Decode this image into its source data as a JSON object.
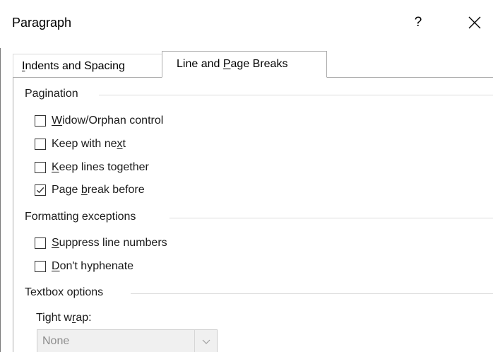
{
  "dialog": {
    "title": "Paragraph",
    "help_label": "?",
    "close_icon": "close-icon"
  },
  "tabs": [
    {
      "label_pre": "",
      "label_ul": "I",
      "label_post": "ndents and Spacing",
      "active": false
    },
    {
      "label_pre": "Line and ",
      "label_ul": "P",
      "label_post": "age Breaks",
      "active": true
    }
  ],
  "pagination": {
    "header": "Pagination",
    "items": [
      {
        "pre": "",
        "ul": "W",
        "post": "idow/Orphan control",
        "checked": false
      },
      {
        "pre": "Keep with ne",
        "ul": "x",
        "post": "t",
        "checked": false
      },
      {
        "pre": "",
        "ul": "K",
        "post": "eep lines together",
        "checked": false
      },
      {
        "pre": "Page ",
        "ul": "b",
        "post": "reak before",
        "checked": true
      }
    ]
  },
  "formatting": {
    "header": "Formatting exceptions",
    "items": [
      {
        "pre": "",
        "ul": "S",
        "post": "uppress line numbers",
        "checked": false
      },
      {
        "pre": "",
        "ul": "D",
        "post": "on't hyphenate",
        "checked": false
      }
    ]
  },
  "textbox": {
    "header": "Textbox options",
    "tight_wrap_pre": "Tight w",
    "tight_wrap_ul": "r",
    "tight_wrap_post": "ap:",
    "tight_wrap_value": "None"
  },
  "colors": {
    "checkbox_border": "#333333",
    "tab_border": "#adadad",
    "disabled_text": "#8c8c8c"
  }
}
